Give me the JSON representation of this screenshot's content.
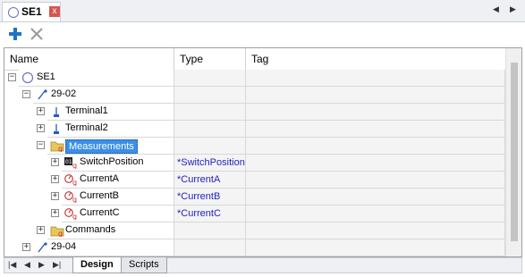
{
  "tab": {
    "title": "SE1",
    "close_glyph": "x"
  },
  "nav": {
    "left": "◀",
    "right": "▶"
  },
  "toolbar": {
    "add_icon": "plus-icon",
    "delete_icon": "delete-icon"
  },
  "columns": {
    "name": "Name",
    "type": "Type",
    "tag": "Tag"
  },
  "rows": [
    {
      "label": "SE1",
      "type": "",
      "exp": "−",
      "icon": "station-icon"
    },
    {
      "label": "29-02",
      "type": "",
      "exp": "−",
      "icon": "bay-icon"
    },
    {
      "label": "Terminal1",
      "type": "",
      "exp": "+",
      "icon": "terminal-icon"
    },
    {
      "label": "Terminal2",
      "type": "",
      "exp": "+",
      "icon": "terminal-icon"
    },
    {
      "label": "Measurements",
      "type": "",
      "exp": "−",
      "icon": "folder-icon",
      "selected": true
    },
    {
      "label": "SwitchPosition",
      "type": "*SwitchPosition",
      "exp": "+",
      "icon": "switch-icon"
    },
    {
      "label": "CurrentA",
      "type": "*CurrentA",
      "exp": "+",
      "icon": "measure-icon"
    },
    {
      "label": "CurrentB",
      "type": "*CurrentB",
      "exp": "+",
      "icon": "measure-icon"
    },
    {
      "label": "CurrentC",
      "type": "*CurrentC",
      "exp": "+",
      "icon": "measure-icon"
    },
    {
      "label": "Commands",
      "type": "",
      "exp": "+",
      "icon": "folder-icon"
    },
    {
      "label": "29-04",
      "type": "",
      "exp": "+",
      "icon": "bay-icon"
    }
  ],
  "bottom_tabs": {
    "design": "Design",
    "scripts": "Scripts"
  },
  "bottom_nav": {
    "first": "|◀",
    "prev": "◀",
    "next": "▶",
    "last": "▶|"
  },
  "colors": {
    "accent": "#3c8fe6",
    "type_text": "#1f1fbf",
    "close_bg": "#d9534f",
    "add_icon": "#1e73c8"
  }
}
